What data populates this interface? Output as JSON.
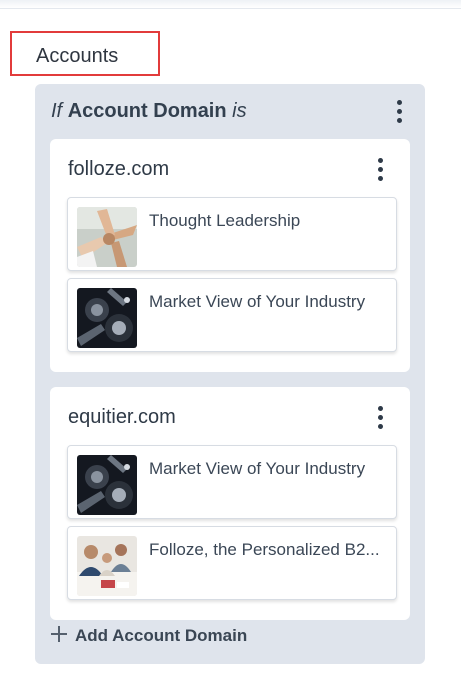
{
  "section_tab": {
    "label": "Accounts"
  },
  "rule": {
    "prefix": "If",
    "field": "Account Domain",
    "operator": "is",
    "add_label": "Add Account Domain"
  },
  "domains": [
    {
      "name": "folloze.com",
      "assets": [
        {
          "title": "Thought Leadership",
          "thumbnail": "hands-teamwork-photo"
        },
        {
          "title": "Market View of Your Industry",
          "thumbnail": "robotic-machinery-photo"
        }
      ]
    },
    {
      "name": "equitier.com",
      "assets": [
        {
          "title": "Market View of Your Industry",
          "thumbnail": "robotic-machinery-photo"
        },
        {
          "title": "Folloze, the Personalized B2...",
          "thumbnail": "business-meeting-photo"
        }
      ]
    }
  ],
  "colors": {
    "highlight_border": "#e23b3b",
    "panel_background": "#dfe4ec",
    "card_background": "#ffffff",
    "text_dark": "#2f3a47"
  }
}
